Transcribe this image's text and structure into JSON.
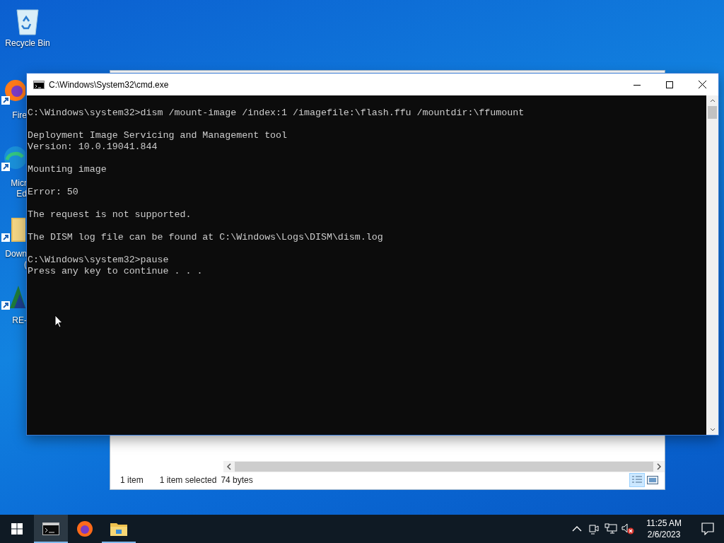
{
  "desktop_icons": [
    {
      "kind": "recycle-bin",
      "lines": [
        "Recycle Bin"
      ]
    },
    {
      "kind": "firefox",
      "lines": [
        "Fire"
      ]
    },
    {
      "kind": "edge",
      "lines": [
        "Micr",
        "Ed"
      ]
    },
    {
      "kind": "folder",
      "lines": [
        "Down",
        "("
      ]
    },
    {
      "kind": "app",
      "lines": [
        "RE-"
      ]
    }
  ],
  "explorer_window": {
    "status_bar": [
      "1 item",
      "1 item selected",
      "74 bytes"
    ],
    "view_buttons": [
      {
        "kind": "details",
        "selected": true
      },
      {
        "kind": "preview",
        "selected": false
      }
    ]
  },
  "console_window": {
    "title": "C:\\Windows\\System32\\cmd.exe",
    "output": [
      [
        "C:\\Windows\\system32>dism /mount-image /index:1 /imagefile:\\flash.ffu /mountdir:\\ffumount"
      ],
      [
        "Deployment Image Servicing and Management tool",
        "Version: 10.0.19041.844"
      ],
      [
        "Mounting image"
      ],
      [
        "Error: 50"
      ],
      [
        "The request is not supported."
      ],
      [
        "The DISM log file can be found at C:\\Windows\\Logs\\DISM\\dism.log"
      ],
      [
        "C:\\Windows\\system32>pause",
        "Press any key to continue . . ."
      ]
    ]
  },
  "taskbar": {
    "apps": [
      {
        "kind": "terminal",
        "active": true,
        "running": true
      },
      {
        "kind": "firefox",
        "active": false,
        "running": false
      },
      {
        "kind": "folder",
        "active": false,
        "running": true
      }
    ],
    "tray": [
      {
        "kind": "chevron"
      },
      {
        "kind": "camera"
      },
      {
        "kind": "network"
      },
      {
        "kind": "volume-muted"
      }
    ],
    "clock": {
      "time": "11:25 AM",
      "date": "2/6/2023"
    }
  }
}
